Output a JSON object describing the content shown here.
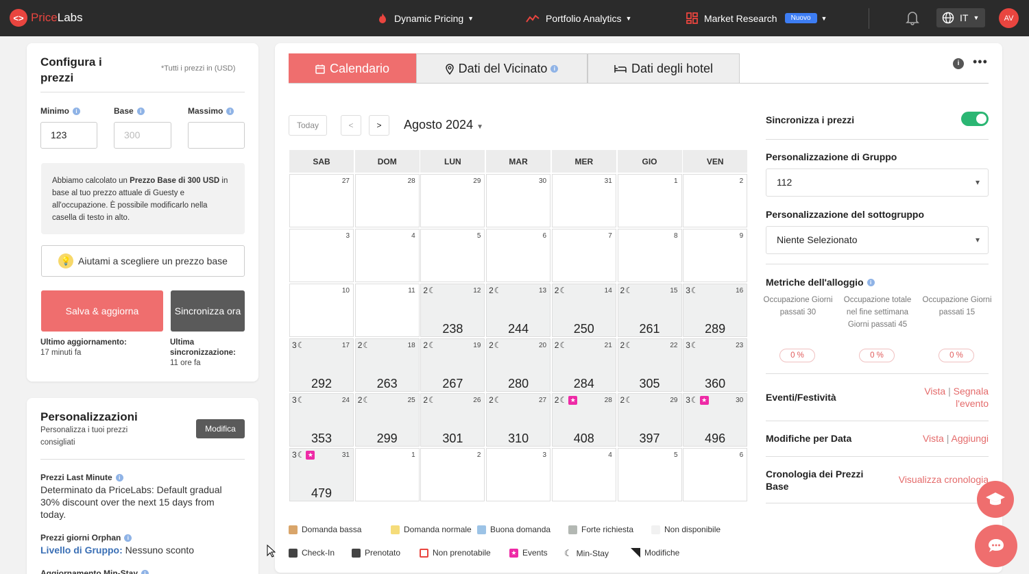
{
  "brand": {
    "name_a": "Price",
    "name_b": "Labs",
    "logo_glyph": "<>"
  },
  "topnav": {
    "dynamic_pricing": "Dynamic Pricing",
    "portfolio_analytics": "Portfolio Analytics",
    "market_research": "Market Research",
    "badge": "Nuovo",
    "lang": "IT",
    "avatar": "AV"
  },
  "config": {
    "title": "Configura i prezzi",
    "note": "*Tutti i prezzi in (USD)",
    "min_label": "Minimo",
    "base_label": "Base",
    "max_label": "Massimo",
    "min_value": "123",
    "base_placeholder": "300",
    "max_value": "",
    "info_pre": "Abbiamo calcolato un ",
    "info_bold": "Prezzo Base di 300 USD",
    "info_post": " in base al tuo prezzo attuale di Guesty e all'occupazione. È possibile modificarlo nella casella di testo in alto.",
    "help_button": "Aiutami a scegliere un prezzo base",
    "save_button": "Salva & aggiorna",
    "sync_button": "Sincronizza ora",
    "last_update_label": "Ultimo aggiornamento:",
    "last_update_value": "17 minuti fa",
    "last_sync_label": "Ultima sincronizzazione:",
    "last_sync_value": "11 ore fa"
  },
  "custom": {
    "title": "Personalizzazioni",
    "subtitle": "Personalizza i tuoi prezzi consigliati",
    "edit_button": "Modifica",
    "last_minute_label": "Prezzi Last Minute",
    "last_minute_text": "Determinato da PriceLabs: Default gradual 30% discount over the next 15 days from today.",
    "orphan_label": "Prezzi giorni Orphan",
    "orphan_level": "Livello di Gruppo:",
    "orphan_value": "Nessuno sconto",
    "minstay_label": "Aggiornamento Min-Stay"
  },
  "tabs": {
    "calendar": "Calendario",
    "neighborhood": "Dati del Vicinato",
    "hotels": "Dati degli hotel"
  },
  "calendar": {
    "today": "Today",
    "prev": "<",
    "next": ">",
    "month": "Agosto 2024",
    "days": [
      "SAB",
      "DOM",
      "LUN",
      "MAR",
      "MER",
      "GIO",
      "VEN"
    ],
    "weeks": [
      [
        {
          "d": "27"
        },
        {
          "d": "28"
        },
        {
          "d": "29"
        },
        {
          "d": "30"
        },
        {
          "d": "31"
        },
        {
          "d": "1"
        },
        {
          "d": "2"
        }
      ],
      [
        {
          "d": "3"
        },
        {
          "d": "4"
        },
        {
          "d": "5"
        },
        {
          "d": "6"
        },
        {
          "d": "7"
        },
        {
          "d": "8"
        },
        {
          "d": "9"
        }
      ],
      [
        {
          "d": "10"
        },
        {
          "d": "11"
        },
        {
          "d": "12",
          "ms": "2",
          "p": "238"
        },
        {
          "d": "13",
          "ms": "2",
          "p": "244"
        },
        {
          "d": "14",
          "ms": "2",
          "p": "250"
        },
        {
          "d": "15",
          "ms": "2",
          "p": "261"
        },
        {
          "d": "16",
          "ms": "3",
          "p": "289"
        }
      ],
      [
        {
          "d": "17",
          "ms": "3",
          "p": "292"
        },
        {
          "d": "18",
          "ms": "2",
          "p": "263"
        },
        {
          "d": "19",
          "ms": "2",
          "p": "267"
        },
        {
          "d": "20",
          "ms": "2",
          "p": "280"
        },
        {
          "d": "21",
          "ms": "2",
          "p": "284"
        },
        {
          "d": "22",
          "ms": "2",
          "p": "305"
        },
        {
          "d": "23",
          "ms": "3",
          "p": "360"
        }
      ],
      [
        {
          "d": "24",
          "ms": "3",
          "p": "353"
        },
        {
          "d": "25",
          "ms": "2",
          "p": "299"
        },
        {
          "d": "26",
          "ms": "2",
          "p": "301"
        },
        {
          "d": "27",
          "ms": "2",
          "p": "310"
        },
        {
          "d": "28",
          "ms": "2",
          "p": "408",
          "ev": true
        },
        {
          "d": "29",
          "ms": "2",
          "p": "397"
        },
        {
          "d": "30",
          "ms": "3",
          "p": "496",
          "ev": true
        }
      ],
      [
        {
          "d": "31",
          "ms": "3",
          "p": "479",
          "ev": true
        },
        {
          "d": "1"
        },
        {
          "d": "2"
        },
        {
          "d": "3"
        },
        {
          "d": "4"
        },
        {
          "d": "5"
        },
        {
          "d": "6"
        }
      ]
    ]
  },
  "legend": {
    "row1": [
      {
        "label": "Domanda bassa",
        "color": "#d9a56a"
      },
      {
        "label": "Domanda normale",
        "color": "#f5dc7a"
      },
      {
        "label": "Buona domanda",
        "color": "#9cc3e6"
      },
      {
        "label": "Forte richiesta",
        "color": "#b3b8b3"
      },
      {
        "label": "Non disponibile",
        "color": "#f1f1f1"
      }
    ],
    "row2": [
      "Check-In",
      "Prenotato",
      "Non prenotabile",
      "Events",
      "Min-Stay",
      "Modifiche"
    ]
  },
  "sidebar": {
    "sync_prices": "Sincronizza i prezzi",
    "group_label": "Personalizzazione di Gruppo",
    "group_value": "112",
    "subgroup_label": "Personalizzazione del sottogruppo",
    "subgroup_value": "Niente Selezionato",
    "metrics_label": "Metriche dell'alloggio",
    "metrics": [
      {
        "label": "Occupazione Giorni passati 30",
        "value": "0 %"
      },
      {
        "label": "Occupazione totale nel fine settimana Giorni passati 45",
        "value": "0 %"
      },
      {
        "label": "Occupazione Giorni passati 15",
        "value": "0 %"
      }
    ],
    "events_label": "Eventi/Festività",
    "events_view": "Vista",
    "events_report": "Segnala l'evento",
    "changes_label": "Modifiche per Data",
    "changes_view": "Vista",
    "changes_add": "Aggiungi",
    "history_label": "Cronologia dei Prezzi Base",
    "history_link": "Visualizza cronologia"
  }
}
